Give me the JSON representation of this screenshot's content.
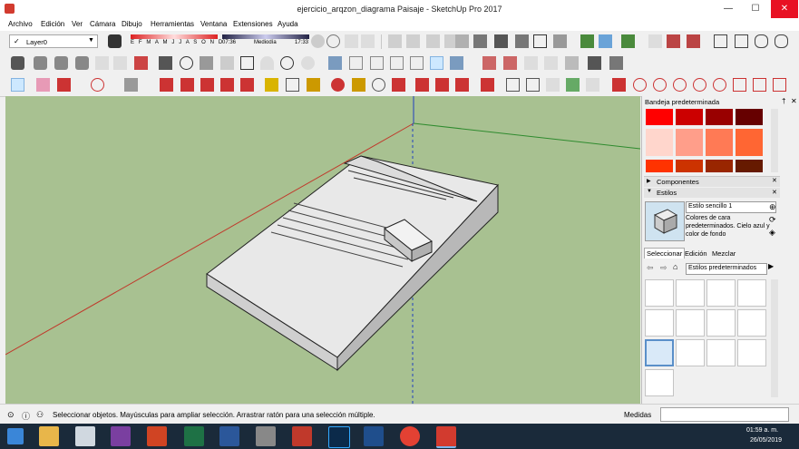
{
  "window": {
    "title": "ejercicio_arqzon_diagrama Paisaje - SketchUp Pro 2017",
    "minimize": "—",
    "maximize": "☐",
    "close": "✕"
  },
  "menu": [
    "Archivo",
    "Edición",
    "Ver",
    "Cámara",
    "Dibujo",
    "Herramientas",
    "Ventana",
    "Extensiones",
    "Ayuda"
  ],
  "layers": {
    "current": "Layer0",
    "check": "✓"
  },
  "shadows": {
    "months": "E F M A M J J A S O N D",
    "time_start": "07:36",
    "time_mid": "Mediodía",
    "time_end": "17:33"
  },
  "tray": {
    "title": "Bandeja predeterminada",
    "pin": "†",
    "close": "✕",
    "materials": {
      "colors": [
        "#ff0000",
        "#cc0000",
        "#990000",
        "#660000",
        "#ffd6cc",
        "#ff9e8a",
        "#ff7a55",
        "#ff6633",
        "#ff3300",
        "#cc3300",
        "#992600",
        "#661a00"
      ]
    },
    "components": {
      "label": "Componentes",
      "arrow": "▶"
    },
    "styles": {
      "label": "Estilos",
      "arrow": "▼",
      "name": "Estilo sencillo 1",
      "description": "Colores de cara predeterminados. Cielo azul y color de fondo",
      "tabs": [
        "Seleccionar",
        "Edición",
        "Mezclar"
      ],
      "collection": "Estilos predeterminados"
    }
  },
  "status": {
    "message": "Seleccionar objetos. Mayúsculas para ampliar selección. Arrastrar ratón para una selección múltiple.",
    "measures_label": "Medidas"
  },
  "taskbar": {
    "time": "01:59 a. m.",
    "date": "26/05/2019"
  },
  "colors": {
    "viewport_bg": "#a8c191",
    "axis_red": "#c0392b",
    "axis_green": "#2e8b2e",
    "axis_blue": "#1f3fbf",
    "selection_blue": "#cde8ff",
    "taskbar": "#1a2a3a"
  }
}
